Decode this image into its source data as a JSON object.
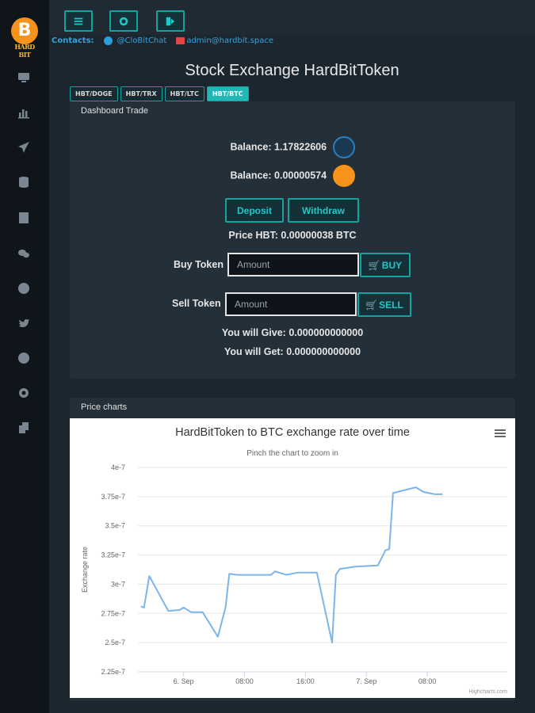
{
  "logo": {
    "letter": "B",
    "text": "HARD BIT"
  },
  "contacts": {
    "label": "Contacts:",
    "telegram": "@CloBitChat",
    "email": "admin@hardbit.space"
  },
  "page_title": "Stock Exchange HardBitToken",
  "tabs": [
    {
      "label": "HBT/DOGE"
    },
    {
      "label": "HBT/TRX"
    },
    {
      "label": "HBT/LTC"
    },
    {
      "label": "HBT/BTC"
    }
  ],
  "dashboard": {
    "title": "Dashboard Trade",
    "balance_hbt": "Balance: 1.17822606",
    "balance_btc": "Balance: 0.00000574",
    "deposit": "Deposit",
    "withdraw": "Withdraw",
    "price": "Price HBT: 0.00000038 BTC",
    "buy_label": "Buy Token",
    "sell_label": "Sell Token",
    "amount_placeholder": "Amount",
    "buy_button": "BUY",
    "sell_button": "SELL",
    "give": "You will Give: 0.000000000000",
    "get": "You will Get: 0.000000000000"
  },
  "charts_panel": {
    "title": "Price charts",
    "menu_icon": "hamburger-icon",
    "credit": "Highcharts.com"
  },
  "colors": {
    "accent": "#17a2a2",
    "line": "#7cb5ec",
    "btc": "#f7931a"
  },
  "chart_data": {
    "type": "line",
    "title": "HardBitToken to BTC exchange rate over time",
    "subtitle": "Pinch the chart to zoom in",
    "ylabel": "Exchange rate",
    "xlabel": "",
    "ylim": [
      2.25e-07,
      4e-07
    ],
    "yticks": [
      "2.25e-7",
      "2.5e-7",
      "2.75e-7",
      "3e-7",
      "3.25e-7",
      "3.5e-7",
      "3.75e-7",
      "4e-7"
    ],
    "yticks_values": [
      2.25e-07,
      2.5e-07,
      2.75e-07,
      3e-07,
      3.25e-07,
      3.5e-07,
      3.75e-07,
      4e-07
    ],
    "xlim": [
      0,
      48.5
    ],
    "xticks": [
      {
        "label": "6. Sep",
        "x": 6
      },
      {
        "label": "08:00",
        "x": 14
      },
      {
        "label": "16:00",
        "x": 22
      },
      {
        "label": "7. Sep",
        "x": 30
      },
      {
        "label": "08:00",
        "x": 38
      }
    ],
    "series": [
      {
        "values": [
          [
            0.4,
            2.81e-07
          ],
          [
            0.8,
            2.8e-07
          ],
          [
            1.5,
            3.07e-07
          ],
          [
            4.0,
            2.77e-07
          ],
          [
            5.5,
            2.78e-07
          ],
          [
            6.0,
            2.8e-07
          ],
          [
            7.0,
            2.76e-07
          ],
          [
            8.5,
            2.76e-07
          ],
          [
            10.5,
            2.55e-07
          ],
          [
            11.5,
            2.8e-07
          ],
          [
            12.0,
            3.09e-07
          ],
          [
            13.0,
            3.08e-07
          ],
          [
            17.5,
            3.08e-07
          ],
          [
            18.0,
            3.11e-07
          ],
          [
            19.5,
            3.08e-07
          ],
          [
            21.0,
            3.1e-07
          ],
          [
            23.5,
            3.1e-07
          ],
          [
            25.5,
            2.5e-07
          ],
          [
            26.0,
            3.08e-07
          ],
          [
            26.5,
            3.13e-07
          ],
          [
            28.5,
            3.15e-07
          ],
          [
            31.5,
            3.16e-07
          ],
          [
            32.5,
            3.29e-07
          ],
          [
            33.0,
            3.3e-07
          ],
          [
            33.5,
            3.78e-07
          ],
          [
            36.5,
            3.83e-07
          ],
          [
            37.5,
            3.79e-07
          ],
          [
            39.0,
            3.77e-07
          ],
          [
            40.0,
            3.77e-07
          ]
        ]
      }
    ]
  }
}
